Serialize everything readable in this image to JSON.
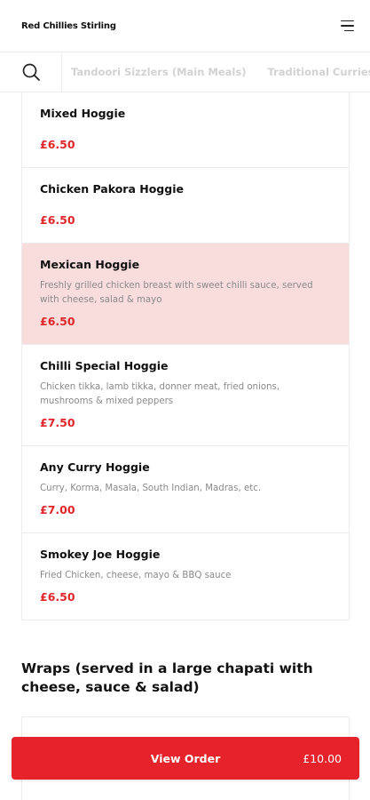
{
  "header": {
    "title": "Red Chillies Stirling",
    "menu_icon": "hamburger-menu-icon"
  },
  "categories": {
    "search_icon": "search-icon",
    "tabs": [
      {
        "label": "Tandoori Sizzlers (Main Meals)"
      },
      {
        "label": "Traditional Curries"
      }
    ]
  },
  "items": [
    {
      "name": "Mixed Hoggie",
      "description": "",
      "price": "£6.50"
    },
    {
      "name": "Chicken Pakora Hoggie",
      "description": "",
      "price": "£6.50"
    },
    {
      "name": "Mexican Hoggie",
      "description": "Freshly grilled chicken breast with sweet chilli sauce, served with cheese, salad & mayo",
      "price": "£6.50"
    },
    {
      "name": "Chilli Special Hoggie",
      "description": "Chicken tikka, lamb tikka, donner meat, fried onions, mushrooms & mixed peppers",
      "price": "£7.50"
    },
    {
      "name": "Any Curry Hoggie",
      "description": "Curry, Korma, Masala, South Indian, Madras, etc.",
      "price": "£7.00"
    },
    {
      "name": "Smokey Joe Hoggie",
      "description": "Fried Chicken, cheese, mayo & BBQ sauce",
      "price": "£6.50"
    }
  ],
  "next_section": {
    "title": "Wraps (served in a large chapati with cheese, sauce & salad)"
  },
  "order_bar": {
    "label": "View Order",
    "total": "£10.00"
  },
  "colors": {
    "accent": "#e6222b",
    "price": "#e0262b",
    "highlight": "#f9dcdc"
  }
}
